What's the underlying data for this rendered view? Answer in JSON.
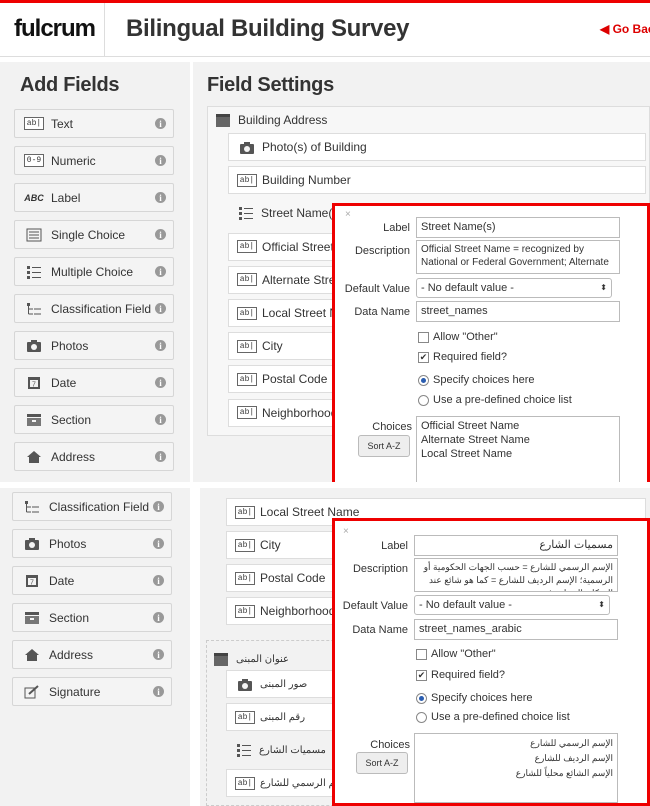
{
  "header": {
    "logo": "fulcrum",
    "title": "Bilingual Building Survey",
    "goback": "◀ Go Back"
  },
  "add_fields": {
    "title": "Add Fields",
    "items": [
      {
        "label": "Text",
        "icon": "text-icon"
      },
      {
        "label": "Numeric",
        "icon": "numeric-icon"
      },
      {
        "label": "Label",
        "icon": "label-icon"
      },
      {
        "label": "Single Choice",
        "icon": "single-choice-icon"
      },
      {
        "label": "Multiple Choice",
        "icon": "multiple-choice-icon"
      },
      {
        "label": "Classification Field",
        "icon": "classification-icon"
      },
      {
        "label": "Photos",
        "icon": "camera-icon"
      },
      {
        "label": "Date",
        "icon": "calendar-icon"
      },
      {
        "label": "Section",
        "icon": "section-icon"
      },
      {
        "label": "Address",
        "icon": "home-icon"
      }
    ],
    "items2": [
      {
        "label": "Classification Field",
        "icon": "classification-icon"
      },
      {
        "label": "Photos",
        "icon": "camera-icon"
      },
      {
        "label": "Date",
        "icon": "calendar-icon"
      },
      {
        "label": "Section",
        "icon": "section-icon"
      },
      {
        "label": "Address",
        "icon": "home-icon"
      },
      {
        "label": "Signature",
        "icon": "signature-icon"
      }
    ]
  },
  "field_settings": {
    "title": "Field Settings",
    "section": "Building Address",
    "rows": [
      "Photo(s) of Building",
      "Building Number",
      "Street Name(s)",
      "Official Street N",
      "Alternate Stree",
      "Local Street Na",
      "City",
      "Postal Code",
      "Neighborhood N"
    ],
    "rows2": [
      "Local Street Name",
      "City",
      "Postal Code",
      "Neighborhood N"
    ],
    "section_ar": "عنوان المبنى",
    "rows_ar": [
      "صور المبنى",
      "رقم المبنى",
      "مسميات الشارع",
      "الإسم الرسمي للشارع"
    ]
  },
  "popup1": {
    "close": "×",
    "label_lbl": "Label",
    "label_val": "Street Name(s)",
    "desc_lbl": "Description",
    "desc_val": "Official Street Name = recognized by National or Federal Government; Alternate",
    "default_lbl": "Default Value",
    "default_val": "- No default value -",
    "dataname_lbl": "Data Name",
    "dataname_val": "street_names",
    "allow_other": "Allow \"Other\"",
    "required": "Required field?",
    "specify": "Specify choices here",
    "predefined": "Use a pre-defined choice list",
    "choices_lbl": "Choices",
    "sort": "Sort A-Z",
    "choices": [
      "Official Street Name",
      "Alternate Street Name",
      "Local Street Name"
    ]
  },
  "popup2": {
    "close": "×",
    "label_lbl": "Label",
    "label_val": "مسميات الشارع",
    "desc_lbl": "Description",
    "desc_val": "الإسم الرسمي للشارع = حسب الجهات الحكومية أو الرسمية؛ الإسم الرديف للشارع = كما هو شائع عند السكان المحليين؛",
    "default_lbl": "Default Value",
    "default_val": "- No default value -",
    "dataname_lbl": "Data Name",
    "dataname_val": "street_names_arabic",
    "allow_other": "Allow \"Other\"",
    "required": "Required field?",
    "specify": "Specify choices here",
    "predefined": "Use a pre-defined choice list",
    "choices_lbl": "Choices",
    "sort": "Sort A-Z",
    "choices": [
      "الإسم الرسمي للشارع",
      "الإسم الرديف للشارع",
      "الإسم الشائع محلياً للشارع"
    ]
  },
  "colors": {
    "accent": "#e00000",
    "panel_bg": "#f2f2f2"
  }
}
